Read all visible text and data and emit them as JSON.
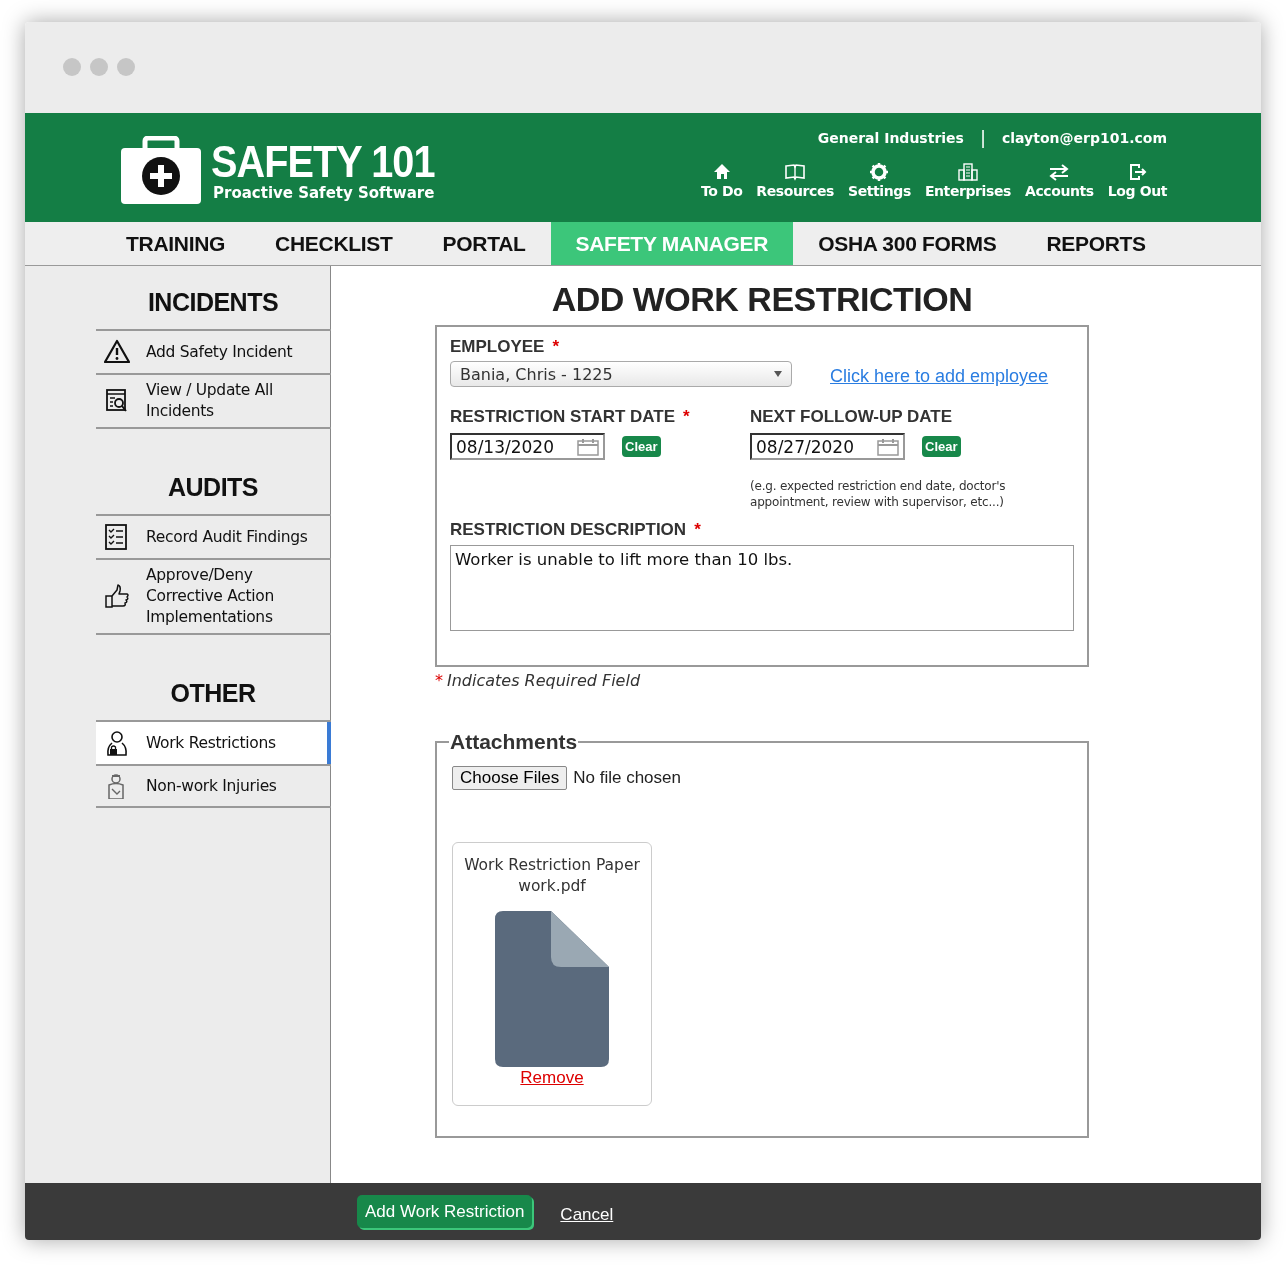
{
  "header": {
    "logo_title": "SAFETY 101",
    "logo_subtitle": "Proactive Safety Software",
    "company": "General Industries",
    "separator": "|",
    "email": "clayton@erp101.com",
    "actions": [
      {
        "label": "To Do",
        "kind": "home"
      },
      {
        "label": "Resources",
        "kind": "book"
      },
      {
        "label": "Settings",
        "kind": "gear"
      },
      {
        "label": "Enterprises",
        "kind": "building"
      },
      {
        "label": "Accounts",
        "kind": "swap"
      },
      {
        "label": "Log Out",
        "kind": "logout"
      }
    ]
  },
  "nav": {
    "tabs": [
      {
        "label": "TRAINING",
        "selected": false
      },
      {
        "label": "CHECKLIST",
        "selected": false
      },
      {
        "label": "PORTAL",
        "selected": false
      },
      {
        "label": "SAFETY MANAGER",
        "selected": true
      },
      {
        "label": "OSHA 300 FORMS",
        "selected": false
      },
      {
        "label": "REPORTS",
        "selected": false
      }
    ]
  },
  "sidebar": {
    "sections": [
      {
        "title": "INCIDENTS",
        "items": [
          {
            "label": "Add Safety Incident",
            "kind": "warning",
            "selected": false
          },
          {
            "label": "View / Update All Incidents",
            "kind": "report",
            "selected": false
          }
        ]
      },
      {
        "title": "AUDITS",
        "items": [
          {
            "label": "Record Audit Findings",
            "kind": "checklist",
            "selected": false
          },
          {
            "label": "Approve/Deny Corrective Action Implementations",
            "kind": "thumb",
            "selected": false
          }
        ]
      },
      {
        "title": "OTHER",
        "items": [
          {
            "label": "Work Restrictions",
            "kind": "person-lock",
            "selected": true
          },
          {
            "label": "Non-work Injuries",
            "kind": "person",
            "selected": false
          }
        ]
      }
    ]
  },
  "form": {
    "title": "ADD WORK RESTRICTION",
    "required_mark": "*",
    "employee": {
      "label": "EMPLOYEE",
      "required": true,
      "value": "Bania, Chris - 1225"
    },
    "add_employee_link": "Click here to add employee",
    "start_date": {
      "label": "RESTRICTION START DATE",
      "required": true,
      "value": "08/13/2020",
      "clear": "Clear"
    },
    "follow_up_date": {
      "label": "NEXT FOLLOW-UP DATE",
      "required": false,
      "value": "08/27/2020",
      "clear": "Clear",
      "hint": "(e.g. expected restriction end date, doctor's appointment, review with supervisor, etc...)"
    },
    "description": {
      "label": "RESTRICTION DESCRIPTION",
      "required": true,
      "value": "Worker is unable to lift more than 10 lbs."
    },
    "required_note": "Indicates Required Field",
    "attachments": {
      "legend": "Attachments",
      "choose_button": "Choose Files",
      "status": "No file chosen",
      "files": [
        {
          "name": "Work Restriction Paper work.pdf",
          "remove": "Remove"
        }
      ]
    }
  },
  "footer": {
    "submit": "Add Work Restriction",
    "cancel": "Cancel"
  }
}
